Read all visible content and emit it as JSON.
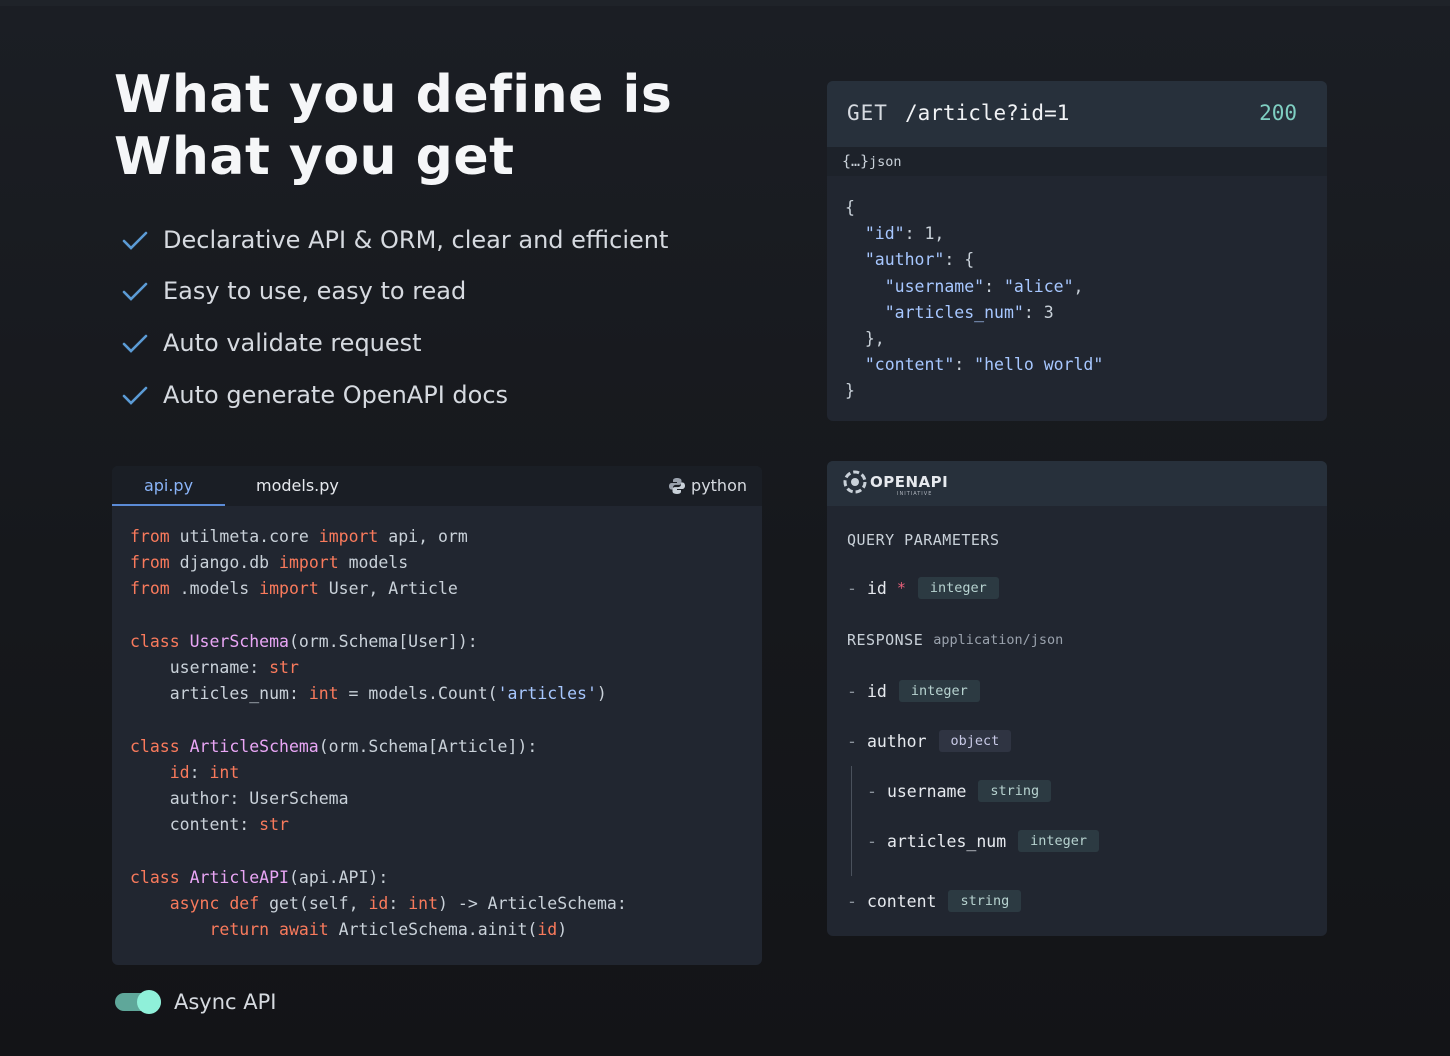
{
  "hero": {
    "title_line1": "What you define is",
    "title_line2": "What you get",
    "features": [
      "Declarative API & ORM, clear and efficient",
      "Easy to use, easy to read",
      "Auto validate request",
      "Auto generate OpenAPI docs"
    ]
  },
  "code_card": {
    "tabs": [
      "api.py",
      "models.py"
    ],
    "active_tab": "api.py",
    "language": "python",
    "code": {
      "l1": {
        "k1": "from",
        "t1": " utilmeta.core ",
        "k2": "import",
        "t2": " api, orm"
      },
      "l2": {
        "k1": "from",
        "t1": " django.db ",
        "k2": "import",
        "t2": " models"
      },
      "l3": {
        "k1": "from",
        "t1": " .models ",
        "k2": "import",
        "t2": " User, Article"
      },
      "l5": {
        "k1": "class",
        "c1": " UserSchema",
        "t1": "(orm.Schema[User]):"
      },
      "l6": {
        "t1": "    username: ",
        "k1": "str"
      },
      "l7": {
        "t1": "    articles_num: ",
        "k1": "int",
        "t2": " = models.Count(",
        "s1": "'articles'",
        "t3": ")"
      },
      "l9": {
        "k1": "class",
        "c1": " ArticleSchema",
        "t1": "(orm.Schema[Article]):"
      },
      "l10": {
        "t0": "    ",
        "k0": "id",
        "t1": ": ",
        "k1": "int"
      },
      "l11": {
        "t1": "    author: UserSchema"
      },
      "l12": {
        "t1": "    content: ",
        "k1": "str"
      },
      "l14": {
        "k1": "class",
        "c1": " ArticleAPI",
        "t1": "(api.API):"
      },
      "l15": {
        "t0": "    ",
        "k1": "async",
        "t1": " ",
        "k2": "def",
        "t2": " get(self, ",
        "k3": "id",
        "t3": ": ",
        "k4": "int",
        "t4": ") -> ArticleSchema:"
      },
      "l16": {
        "t0": "        ",
        "k1": "return",
        "t1": " ",
        "k2": "await",
        "t2": " ArticleSchema.ainit(",
        "k3": "id",
        "t3": ")"
      }
    }
  },
  "toggle": {
    "label": "Async API",
    "on": true
  },
  "response": {
    "method": "GET",
    "path": "/article?id=1",
    "status": "200",
    "format_label": "json",
    "braces": "{…}",
    "json": {
      "open": "{",
      "id_key": "\"id\"",
      "id_val": ": 1,",
      "author_key": "\"author\"",
      "author_open": ": {",
      "username_key": "\"username\"",
      "username_sep": ": ",
      "username_val": "\"alice\"",
      "username_end": ",",
      "articles_key": "\"articles_num\"",
      "articles_val": ": 3",
      "author_close": "},",
      "content_key": "\"content\"",
      "content_sep": ": ",
      "content_val": "\"hello world\"",
      "close": "}"
    }
  },
  "openapi": {
    "logo_word": "OPENAPI",
    "logo_sub": "INITIATIVE",
    "query_title": "QUERY PARAMETERS",
    "query_params": [
      {
        "name": "id",
        "required_mark": "*",
        "type": "integer"
      }
    ],
    "response_title": "RESPONSE",
    "response_content_type": "application/json",
    "fields": {
      "id": {
        "name": "id",
        "type": "integer"
      },
      "author": {
        "name": "author",
        "type": "object"
      },
      "username": {
        "name": "username",
        "type": "string"
      },
      "articles_num": {
        "name": "articles_num",
        "type": "integer"
      },
      "content": {
        "name": "content",
        "type": "string"
      }
    },
    "dash": "-"
  },
  "colors": {
    "accent_teal": "#7fcfc2",
    "keyword": "#f97a5c",
    "class_name": "#e9a6f5",
    "string": "#a7c7ff",
    "check": "#5b9bd5"
  }
}
